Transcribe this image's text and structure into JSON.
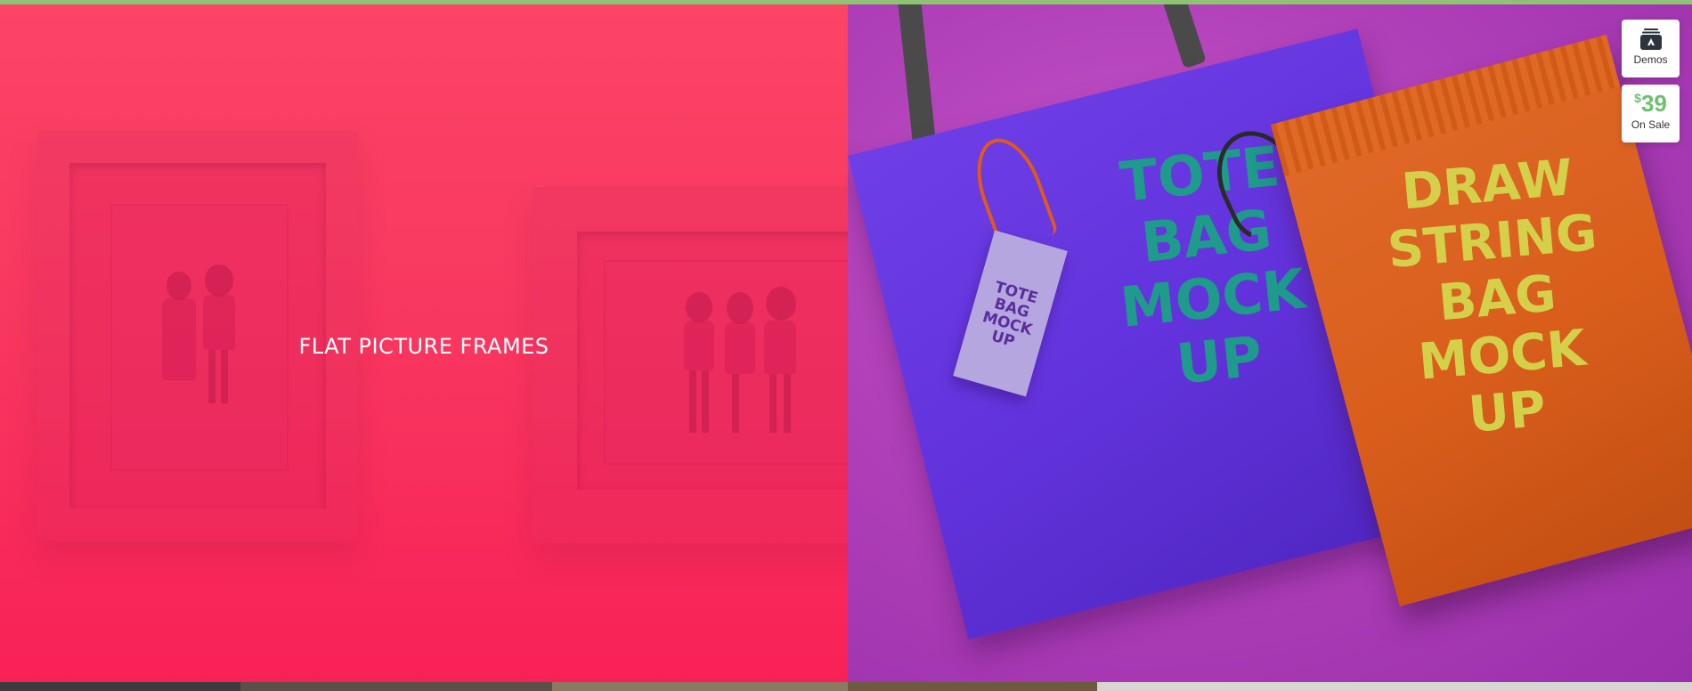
{
  "colors": {
    "top_bar": "#8fc374",
    "left_overlay": "#f82b5c",
    "right_background": "#b040b8",
    "tote_bag": "#6233dc",
    "drawstring_bag": "#d95e1c",
    "price_green": "#6cc070"
  },
  "tiles": [
    {
      "title": "FLAT PICTURE FRAMES",
      "image": "picture-frames-illustrations"
    },
    {
      "title": "",
      "image": "tote-and-drawstring-bags",
      "tote_print": "TOTE\nBAG\nMOCK\nUP",
      "tag_print": "TOTE\nBAG\nMOCK\nUP",
      "drawstring_print": "DRAW\nSTRING\nBAG\nMOCK\nUP"
    }
  ],
  "widgets": {
    "demos": {
      "icon": "stack-icon",
      "label": "Demos"
    },
    "sale": {
      "currency": "$",
      "price": "39",
      "label": "On Sale"
    }
  }
}
